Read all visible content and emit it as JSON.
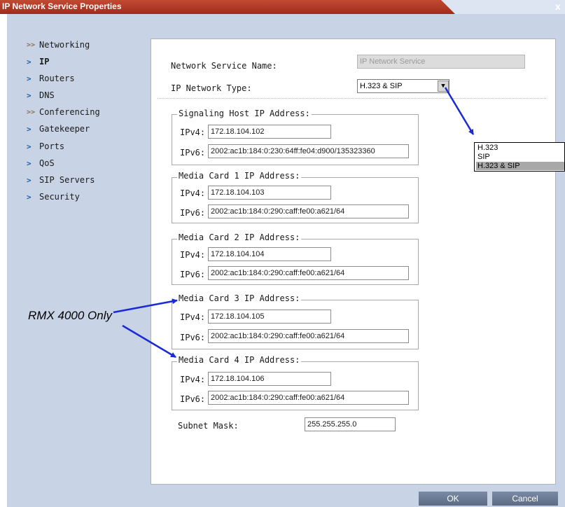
{
  "window": {
    "title": "IP Network Service Properties",
    "close_glyph": "x"
  },
  "sidebar": {
    "items": [
      {
        "label": "Networking",
        "icon": "double-chevron-icon"
      },
      {
        "label": "IP",
        "icon": "chevron-right-icon",
        "active": true
      },
      {
        "label": "Routers",
        "icon": "chevron-right-icon"
      },
      {
        "label": "DNS",
        "icon": "chevron-right-icon"
      },
      {
        "label": "Conferencing",
        "icon": "double-chevron-icon"
      },
      {
        "label": "Gatekeeper",
        "icon": "chevron-right-icon"
      },
      {
        "label": "Ports",
        "icon": "chevron-right-icon"
      },
      {
        "label": "QoS",
        "icon": "chevron-right-icon"
      },
      {
        "label": "SIP Servers",
        "icon": "chevron-right-icon"
      },
      {
        "label": "Security",
        "icon": "chevron-right-icon"
      }
    ]
  },
  "form": {
    "service_name_label": "Network Service Name:",
    "service_name_value": "IP Network Service",
    "network_type_label": "IP Network Type:",
    "network_type_value": "H.323 & SIP",
    "network_type_options": [
      "H.323",
      "SIP",
      "H.323 & SIP"
    ],
    "ipv4_label": "IPv4:",
    "ipv6_label": "IPv6:",
    "groups": [
      {
        "title": "Signaling Host IP Address:",
        "ipv4": "172.18.104.102",
        "ipv6": "2002:ac1b:184:0:230:64ff:fe04:d900/135323360"
      },
      {
        "title": "Media Card 1 IP Address:",
        "ipv4": "172.18.104.103",
        "ipv6": "2002:ac1b:184:0:290:caff:fe00:a621/64"
      },
      {
        "title": "Media Card 2 IP Address:",
        "ipv4": "172.18.104.104",
        "ipv6": "2002:ac1b:184:0:290:caff:fe00:a621/64"
      },
      {
        "title": "Media Card 3 IP Address:",
        "ipv4": "172.18.104.105",
        "ipv6": "2002:ac1b:184:0:290:caff:fe00:a621/64"
      },
      {
        "title": "Media Card 4 IP Address:",
        "ipv4": "172.18.104.106",
        "ipv6": "2002:ac1b:184:0:290:caff:fe00:a621/64"
      }
    ],
    "subnet_label": "Subnet Mask:",
    "subnet_value": "255.255.255.0"
  },
  "annotation": {
    "text": "RMX 4000 Only",
    "arrow_color": "#1a2bd6"
  },
  "buttons": {
    "ok": "OK",
    "cancel": "Cancel"
  },
  "colors": {
    "title_bar": "#b23a25",
    "dialog_bg": "#c8d3e6",
    "button": "#6b7993",
    "accent_chevron": "#1e5fa8"
  }
}
